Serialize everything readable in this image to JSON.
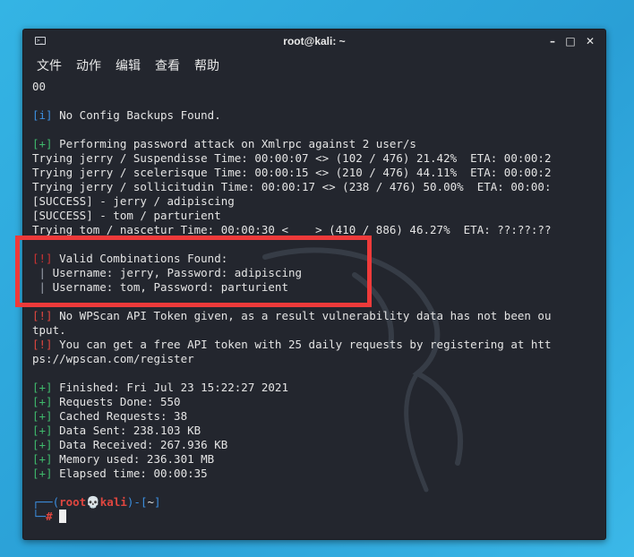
{
  "window": {
    "title": "root@kali: ~",
    "icon": "terminal-icon",
    "controls": [
      "minimize",
      "maximize",
      "close"
    ]
  },
  "menu": [
    "文件",
    "动作",
    "编辑",
    "查看",
    "帮助"
  ],
  "terminal_lines": [
    {
      "segments": [
        {
          "t": "00",
          "c": ""
        }
      ]
    },
    {
      "segments": []
    },
    {
      "segments": [
        {
          "t": "[i]",
          "c": "blue"
        },
        {
          "t": " No Config Backups Found.",
          "c": ""
        }
      ]
    },
    {
      "segments": []
    },
    {
      "segments": [
        {
          "t": "[+]",
          "c": "green"
        },
        {
          "t": " Performing password attack on Xmlrpc against 2 user/s",
          "c": ""
        }
      ]
    },
    {
      "segments": [
        {
          "t": "Trying jerry / Suspendisse Time: 00:00:07 <> (102 / 476) 21.42%  ETA: 00:00:2",
          "c": ""
        }
      ]
    },
    {
      "segments": [
        {
          "t": "Trying jerry / scelerisque Time: 00:00:15 <> (210 / 476) 44.11%  ETA: 00:00:2",
          "c": ""
        }
      ]
    },
    {
      "segments": [
        {
          "t": "Trying jerry / sollicitudin Time: 00:00:17 <> (238 / 476) 50.00%  ETA: 00:00:",
          "c": ""
        }
      ]
    },
    {
      "segments": [
        {
          "t": "[SUCCESS] - jerry / adipiscing",
          "c": ""
        }
      ]
    },
    {
      "segments": [
        {
          "t": "[SUCCESS] - tom / parturient",
          "c": ""
        }
      ]
    },
    {
      "segments": [
        {
          "t": "Trying tom / nascetur Time: 00:00:30 <    > (410 / 886) 46.27%  ETA: ??:??:??",
          "c": ""
        }
      ]
    },
    {
      "segments": []
    },
    {
      "segments": [
        {
          "t": "[!]",
          "c": "dkred"
        },
        {
          "t": " Valid Combinations Found:",
          "c": ""
        }
      ]
    },
    {
      "segments": [
        {
          "t": " | ",
          "c": "pipe"
        },
        {
          "t": "Username: jerry, Password: adipiscing",
          "c": ""
        }
      ]
    },
    {
      "segments": [
        {
          "t": " | ",
          "c": "pipe"
        },
        {
          "t": "Username: tom, Password: parturient",
          "c": ""
        }
      ]
    },
    {
      "segments": []
    },
    {
      "segments": [
        {
          "t": "[!]",
          "c": "red"
        },
        {
          "t": " No WPScan API Token given, as a result vulnerability data has not been ou",
          "c": ""
        }
      ]
    },
    {
      "segments": [
        {
          "t": "tput.",
          "c": ""
        }
      ]
    },
    {
      "segments": [
        {
          "t": "[!]",
          "c": "red"
        },
        {
          "t": " You can get a free API token with 25 daily requests by registering at htt",
          "c": ""
        }
      ]
    },
    {
      "segments": [
        {
          "t": "ps://wpscan.com/register",
          "c": ""
        }
      ]
    },
    {
      "segments": []
    },
    {
      "segments": [
        {
          "t": "[+]",
          "c": "green"
        },
        {
          "t": " Finished: Fri Jul 23 15:22:27 2021",
          "c": ""
        }
      ]
    },
    {
      "segments": [
        {
          "t": "[+]",
          "c": "green"
        },
        {
          "t": " Requests Done: 550",
          "c": ""
        }
      ]
    },
    {
      "segments": [
        {
          "t": "[+]",
          "c": "green"
        },
        {
          "t": " Cached Requests: 38",
          "c": ""
        }
      ]
    },
    {
      "segments": [
        {
          "t": "[+]",
          "c": "green"
        },
        {
          "t": " Data Sent: 238.103 KB",
          "c": ""
        }
      ]
    },
    {
      "segments": [
        {
          "t": "[+]",
          "c": "green"
        },
        {
          "t": " Data Received: 267.936 KB",
          "c": ""
        }
      ]
    },
    {
      "segments": [
        {
          "t": "[+]",
          "c": "green"
        },
        {
          "t": " Memory used: 236.301 MB",
          "c": ""
        }
      ]
    },
    {
      "segments": [
        {
          "t": "[+]",
          "c": "green"
        },
        {
          "t": " Elapsed time: 00:00:35",
          "c": ""
        }
      ]
    },
    {
      "segments": []
    },
    {
      "segments": [
        {
          "t": "┌──(",
          "c": "prompt-blue"
        },
        {
          "t": "root💀kali",
          "c": "prompt-red"
        },
        {
          "t": ")-[",
          "c": "prompt-blue"
        },
        {
          "t": "~",
          "c": ""
        },
        {
          "t": "]",
          "c": "prompt-blue"
        }
      ]
    },
    {
      "segments": [
        {
          "t": "└─",
          "c": "prompt-blue"
        },
        {
          "t": "#",
          "c": "prompt-red"
        },
        {
          "t": " ",
          "c": ""
        }
      ],
      "cursor": true
    }
  ],
  "colors": {
    "terminal_bg": "#23262e",
    "highlight_border": "#ee3a3a",
    "info_blue": "#3c8fe0",
    "success_green": "#3fb96c",
    "warning_red": "#e0463f"
  }
}
